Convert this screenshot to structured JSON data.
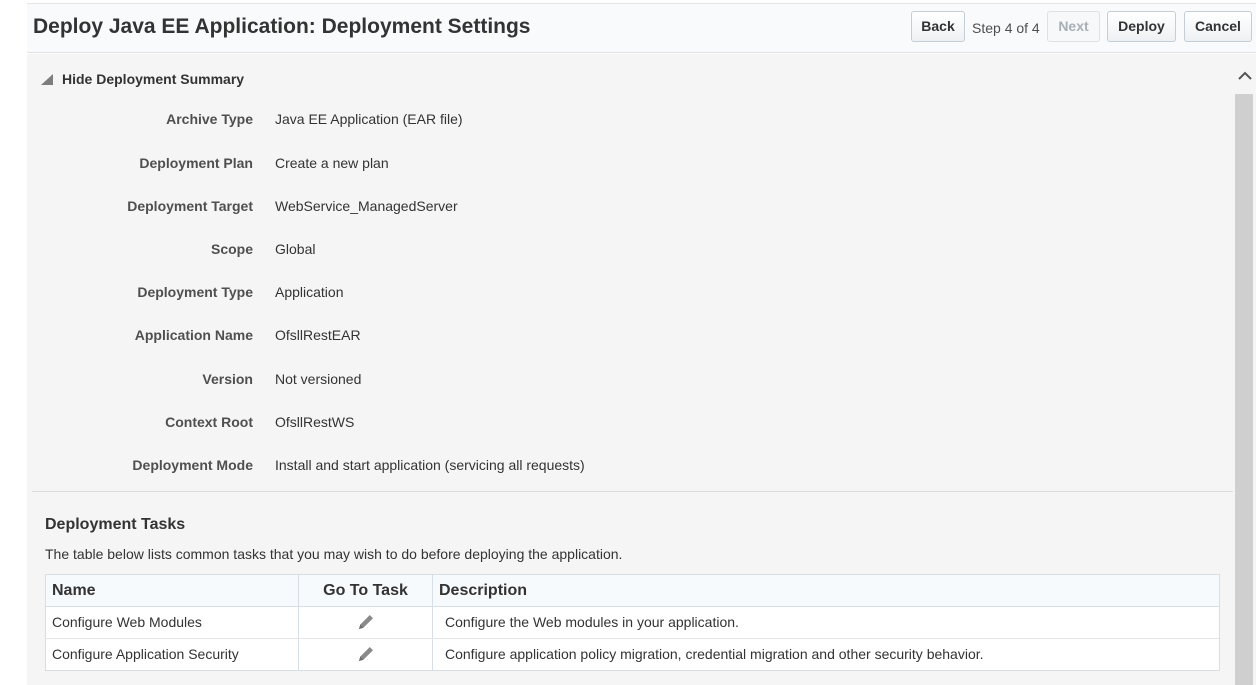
{
  "header": {
    "title": "Deploy Java EE Application: Deployment Settings",
    "back_label": "Back",
    "step_text": "Step 4 of 4",
    "next_label": "Next",
    "deploy_label": "Deploy",
    "cancel_label": "Cancel"
  },
  "summary": {
    "toggle_label": "Hide Deployment Summary",
    "rows": [
      {
        "label": "Archive Type",
        "value": "Java EE Application (EAR file)"
      },
      {
        "label": "Deployment Plan",
        "value": "Create a new plan"
      },
      {
        "label": "Deployment Target",
        "value": "WebService_ManagedServer"
      },
      {
        "label": "Scope",
        "value": "Global"
      },
      {
        "label": "Deployment Type",
        "value": "Application"
      },
      {
        "label": "Application Name",
        "value": "OfsllRestEAR"
      },
      {
        "label": "Version",
        "value": "Not versioned"
      },
      {
        "label": "Context Root",
        "value": "OfsllRestWS"
      },
      {
        "label": "Deployment Mode",
        "value": "Install and start application (servicing all requests)"
      }
    ]
  },
  "tasks": {
    "title": "Deployment Tasks",
    "description": "The table below lists common tasks that you may wish to do before deploying the application.",
    "columns": [
      "Name",
      "Go To Task",
      "Description"
    ],
    "rows": [
      {
        "name": "Configure Web Modules",
        "icon": "edit-pencil-icon",
        "description": "Configure the Web modules in your application."
      },
      {
        "name": "Configure Application Security",
        "icon": "edit-pencil-icon",
        "description": "Configure application policy migration, credential migration and other security behavior."
      }
    ]
  },
  "colors": {
    "content_bg": "#f5f5f5",
    "header_bg": "#f9fafb",
    "table_border": "#d6dfe6",
    "icon_gray": "#8a8a8a"
  }
}
